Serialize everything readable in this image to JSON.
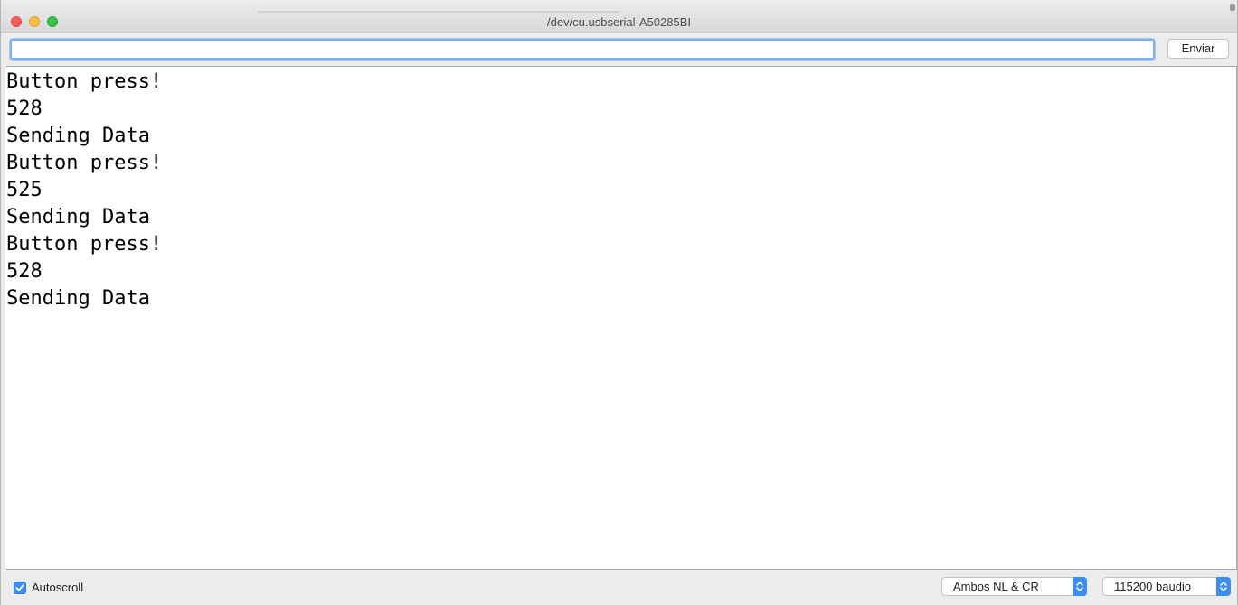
{
  "window": {
    "title": "/dev/cu.usbserial-A50285BI"
  },
  "toolbar": {
    "input_value": "",
    "send_label": "Enviar"
  },
  "output": {
    "lines": [
      "Button press!",
      "528",
      "Sending Data",
      "Button press!",
      "525",
      "Sending Data",
      "Button press!",
      "528",
      "Sending Data"
    ]
  },
  "statusbar": {
    "autoscroll_label": "Autoscroll",
    "autoscroll_checked": true,
    "line_ending_selected": "Ambos NL & CR",
    "baud_selected": "115200 baudio"
  },
  "icons": {
    "close": "close-icon",
    "minimize": "minimize-icon",
    "zoom": "zoom-icon",
    "check": "checkmark-icon",
    "select_arrows": "up-down-chevron-icon"
  },
  "colors": {
    "accent": "#3b8ef4",
    "close": "#fc605c",
    "minimize": "#fdbc40",
    "zoom": "#34c84a",
    "focus_ring": "#7eb1f0"
  }
}
